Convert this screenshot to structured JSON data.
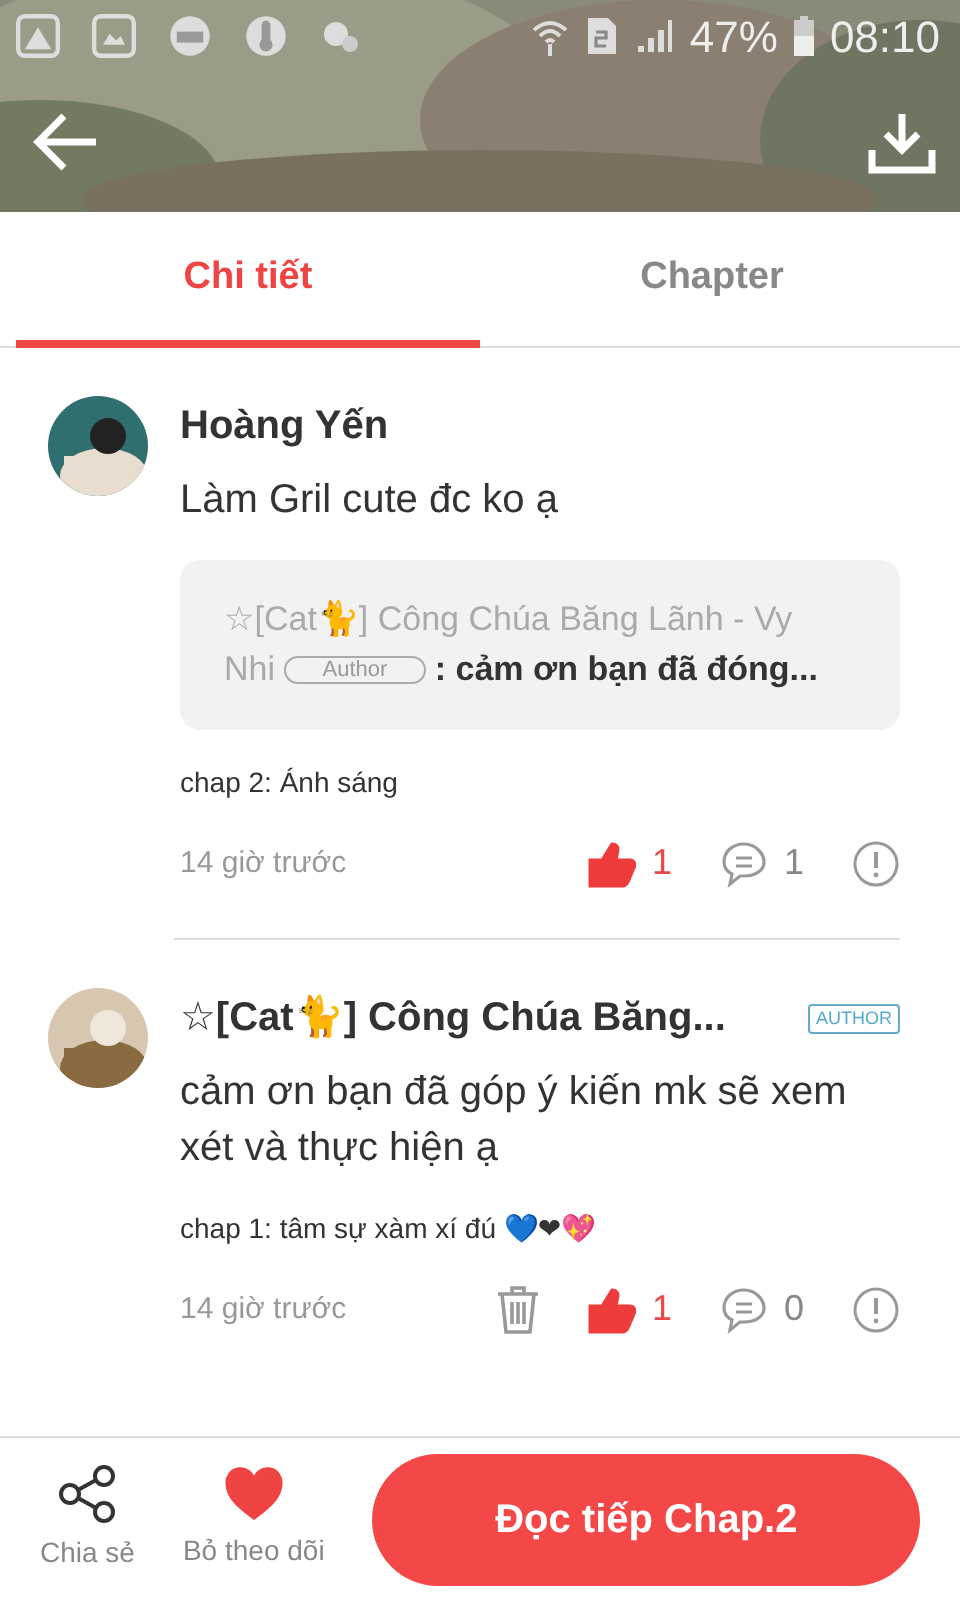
{
  "status_bar": {
    "battery": "47%",
    "time": "08:10"
  },
  "tabs": [
    {
      "label": "Chi tiết",
      "selected": true
    },
    {
      "label": "Chapter",
      "selected": false
    }
  ],
  "comments": [
    {
      "author": "Hoàng Yến",
      "text": "Làm Gril cute đc ko ạ",
      "quote": {
        "author": "☆[Cat🐈] Công Chúa Băng Lãnh - Vy Nhi",
        "badge": "Author",
        "text": ": cảm ơn bạn đã đóng..."
      },
      "chapter": "chap 2: Ánh sáng",
      "time": "14 giờ trước",
      "deletable": false,
      "liked": true,
      "likes": "1",
      "replies": "1"
    },
    {
      "author": "☆[Cat🐈] Công Chúa Băng...",
      "author_badge": "AUTHOR",
      "text": "cảm ơn bạn đã góp ý kiến mk sẽ xem xét và thực hiện ạ",
      "chapter": "chap 1: tâm sự xàm xí đú 💙❤💖",
      "time": "14 giờ trước",
      "deletable": true,
      "liked": true,
      "likes": "1",
      "replies": "0"
    }
  ],
  "bottom_bar": {
    "share_label": "Chia sẻ",
    "follow_label": "Bỏ theo dõi",
    "following": true,
    "read_button": "Đọc tiếp Chap.2"
  }
}
